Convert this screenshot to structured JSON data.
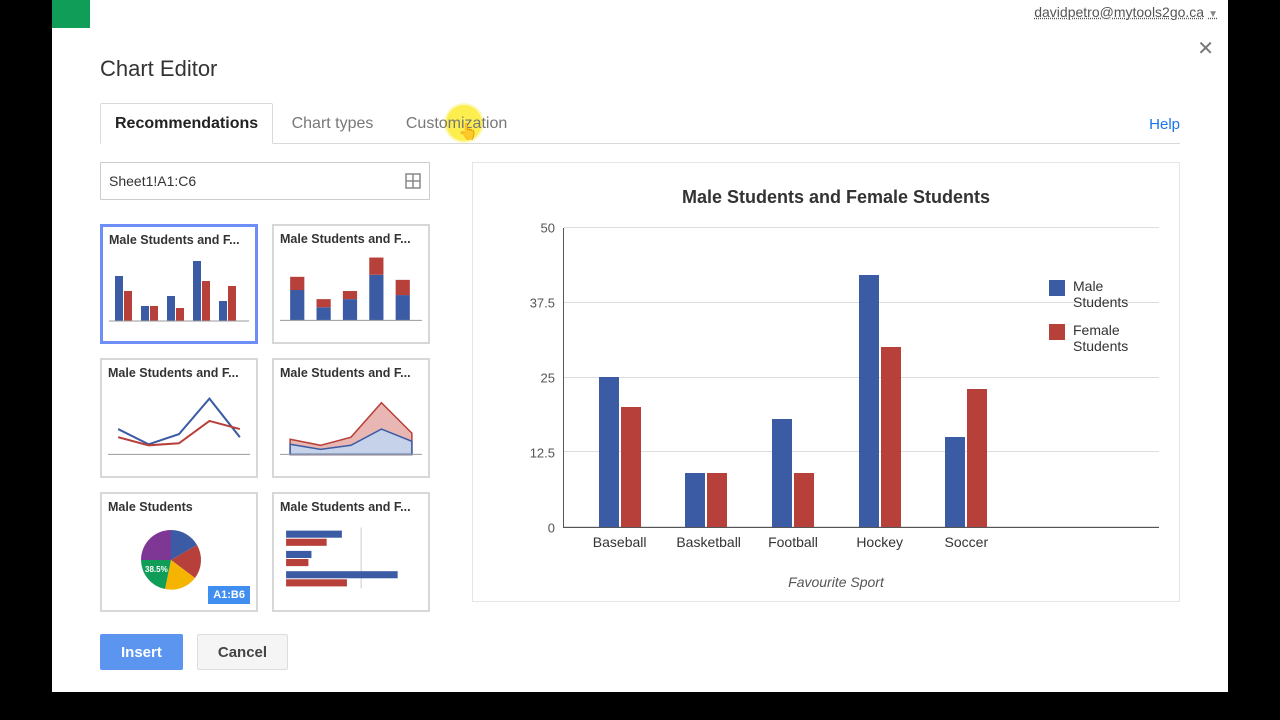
{
  "header": {
    "account_email": "davidpetro@mytools2go.ca"
  },
  "dialog": {
    "title": "Chart Editor",
    "help_label": "Help"
  },
  "tabs": [
    "Recommendations",
    "Chart types",
    "Customization"
  ],
  "range": {
    "value": "Sheet1!A1:C6"
  },
  "thumbs": [
    {
      "label": "Male Students and F..."
    },
    {
      "label": "Male Students and F..."
    },
    {
      "label": "Male Students and F..."
    },
    {
      "label": "Male Students and F..."
    },
    {
      "label": "Male Students",
      "badge": "A1:B6",
      "pie_pct": "38.5%"
    },
    {
      "label": "Male Students and F..."
    }
  ],
  "buttons": {
    "insert": "Insert",
    "cancel": "Cancel"
  },
  "chart_data": {
    "type": "bar",
    "title": "Male Students and Female Students",
    "xlabel": "Favourite Sport",
    "ylabel": "",
    "ylim": [
      0,
      50
    ],
    "yticks": [
      0,
      12.5,
      25,
      37.5,
      50
    ],
    "categories": [
      "Baseball",
      "Basketball",
      "Football",
      "Hockey",
      "Soccer"
    ],
    "series": [
      {
        "name": "Male Students",
        "color": "#3b5ba5",
        "values": [
          25,
          9,
          18,
          42,
          15
        ]
      },
      {
        "name": "Female Students",
        "color": "#b7403a",
        "values": [
          20,
          9,
          9,
          30,
          23
        ]
      }
    ]
  }
}
